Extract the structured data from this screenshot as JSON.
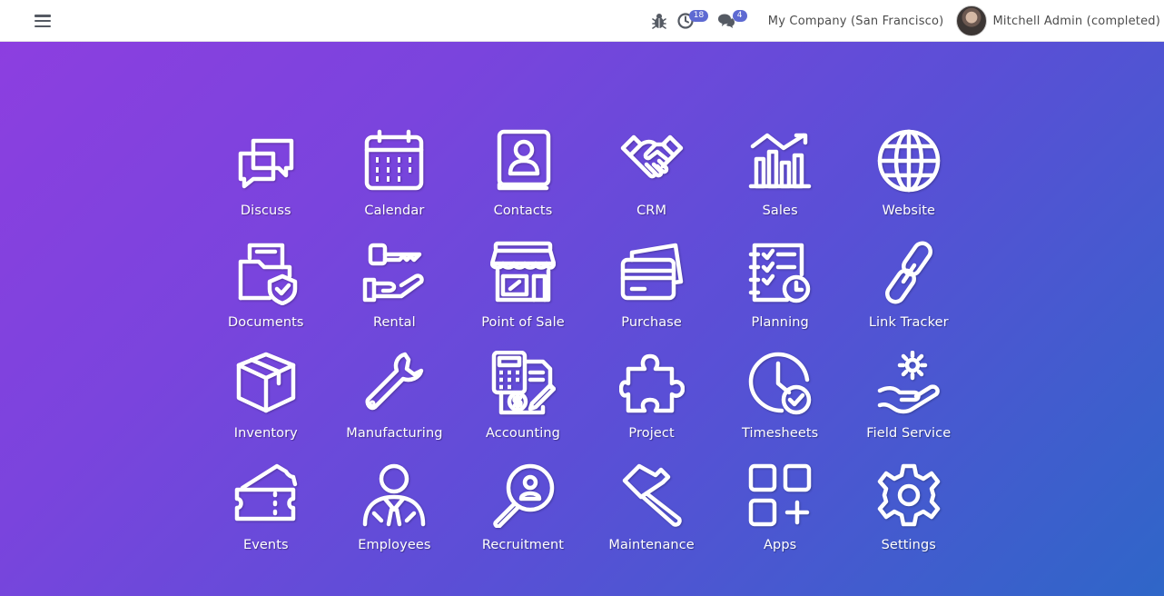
{
  "navbar": {
    "activity_count": "18",
    "messages_count": "4",
    "company": "My Company (San Francisco)",
    "user": "Mitchell Admin (completed)"
  },
  "apps": [
    {
      "label": "Discuss",
      "icon": "chat-bubbles-icon"
    },
    {
      "label": "Calendar",
      "icon": "calendar-icon"
    },
    {
      "label": "Contacts",
      "icon": "address-book-icon"
    },
    {
      "label": "CRM",
      "icon": "handshake-icon"
    },
    {
      "label": "Sales",
      "icon": "bar-chart-icon"
    },
    {
      "label": "Website",
      "icon": "globe-icon"
    },
    {
      "label": "Documents",
      "icon": "folder-shield-icon"
    },
    {
      "label": "Rental",
      "icon": "key-hand-icon"
    },
    {
      "label": "Point of Sale",
      "icon": "shop-icon"
    },
    {
      "label": "Purchase",
      "icon": "credit-cards-icon"
    },
    {
      "label": "Planning",
      "icon": "checklist-clock-icon"
    },
    {
      "label": "Link Tracker",
      "icon": "chain-link-icon"
    },
    {
      "label": "Inventory",
      "icon": "box-icon"
    },
    {
      "label": "Manufacturing",
      "icon": "wrench-icon"
    },
    {
      "label": "Accounting",
      "icon": "calculator-invoice-icon"
    },
    {
      "label": "Project",
      "icon": "puzzle-icon"
    },
    {
      "label": "Timesheets",
      "icon": "clock-check-icon"
    },
    {
      "label": "Field Service",
      "icon": "gear-hand-icon"
    },
    {
      "label": "Events",
      "icon": "ticket-icon"
    },
    {
      "label": "Employees",
      "icon": "employee-icon"
    },
    {
      "label": "Recruitment",
      "icon": "magnifier-person-icon"
    },
    {
      "label": "Maintenance",
      "icon": "hammer-icon"
    },
    {
      "label": "Apps",
      "icon": "app-grid-icon"
    },
    {
      "label": "Settings",
      "icon": "gear-icon"
    }
  ]
}
